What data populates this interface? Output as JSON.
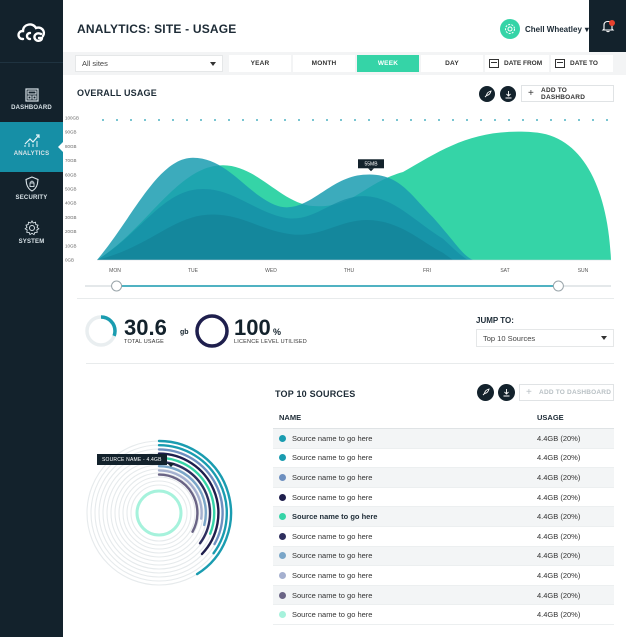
{
  "header": {
    "title": "ANALYTICS: SITE - USAGE",
    "user_name": "Chell Wheatley",
    "user_caret": "▾"
  },
  "sidebar": {
    "items": [
      {
        "label": "DASHBOARD",
        "icon": "dashboard-icon"
      },
      {
        "label": "ANALYTICS",
        "icon": "analytics-icon"
      },
      {
        "label": "SECURITY",
        "icon": "shield-icon"
      },
      {
        "label": "SYSTEM",
        "icon": "gear-icon"
      }
    ],
    "active": "ANALYTICS"
  },
  "filters": {
    "site_select": "All sites",
    "tabs": [
      "YEAR",
      "MONTH",
      "WEEK",
      "DAY"
    ],
    "active_tab": "WEEK",
    "date_from": "DATE FROM",
    "date_to": "DATE TO"
  },
  "overall": {
    "title": "OVERALL USAGE",
    "add_label": "ADD TO DASHBOARD"
  },
  "chart_data": {
    "type": "area",
    "categories": [
      "MON",
      "TUE",
      "WED",
      "THU",
      "FRI",
      "SAT",
      "SUN"
    ],
    "y_ticks": [
      "100GB",
      "90GB",
      "80GB",
      "70GB",
      "60GB",
      "50GB",
      "40GB",
      "30GB",
      "20GB",
      "10GB",
      "0GB"
    ],
    "ylim": [
      0,
      100
    ],
    "tooltip": "55MB",
    "colors": [
      "#35d4a7",
      "#1a9cb0",
      "#168fa6",
      "#127e95"
    ],
    "range_slider": {
      "start": 0.06,
      "end": 0.9
    }
  },
  "totals": {
    "usage_value": "30.6",
    "usage_unit": "gb",
    "usage_label": "TOTAL USAGE",
    "usage_fraction": 0.306,
    "licence_value": "100",
    "licence_unit": "%",
    "licence_label": "LICENCE LEVEL UTILISED",
    "licence_fraction": 1.0,
    "jump_label": "JUMP TO:",
    "jump_value": "Top 10 Sources"
  },
  "sources": {
    "title": "TOP 10 SOURCES",
    "add_label": "ADD TO DASHBOARD",
    "tooltip": "SOURCE NAME - 4.4GB",
    "columns": [
      "NAME",
      "USAGE"
    ],
    "rows": [
      {
        "name": "Source name to go here",
        "usage": "4.4GB (20%)",
        "color": "#1a9cb0"
      },
      {
        "name": "Source name to go here",
        "usage": "4.4GB (20%)",
        "color": "#1a9cb0"
      },
      {
        "name": "Source name to go here",
        "usage": "4.4GB (20%)",
        "color": "#6d8fbf"
      },
      {
        "name": "Source name to go here",
        "usage": "4.4GB (20%)",
        "color": "#1f1f4d"
      },
      {
        "name": "Source name to go here",
        "usage": "4.4GB (20%)",
        "color": "#35d4a7",
        "bold": true
      },
      {
        "name": "Source name to go here",
        "usage": "4.4GB (20%)",
        "color": "#2e2f5e"
      },
      {
        "name": "Source name to go here",
        "usage": "4.4GB (20%)",
        "color": "#7aa6c8"
      },
      {
        "name": "Source name to go here",
        "usage": "4.4GB (20%)",
        "color": "#a5b0cf"
      },
      {
        "name": "Source name to go here",
        "usage": "4.4GB (20%)",
        "color": "#6a6485"
      },
      {
        "name": "Source name to go here",
        "usage": "4.4GB (20%)",
        "color": "#a6f2dc"
      }
    ],
    "rings": [
      {
        "color": "#1a9cb0",
        "sweep": 0.3
      },
      {
        "color": "#1a9cb0",
        "sweep": 0.24
      },
      {
        "color": "#6d8fbf",
        "sweep": 0.22
      },
      {
        "color": "#1f1f4d",
        "sweep": 0.26
      },
      {
        "color": "#35d4a7",
        "sweep": 0.2
      },
      {
        "color": "#2e2f5e",
        "sweep": 0.24
      },
      {
        "color": "#7aa6c8",
        "sweep": 0.18
      },
      {
        "color": "#a5b0cf",
        "sweep": 0.16
      },
      {
        "color": "#6a6485",
        "sweep": 0.22
      }
    ]
  }
}
